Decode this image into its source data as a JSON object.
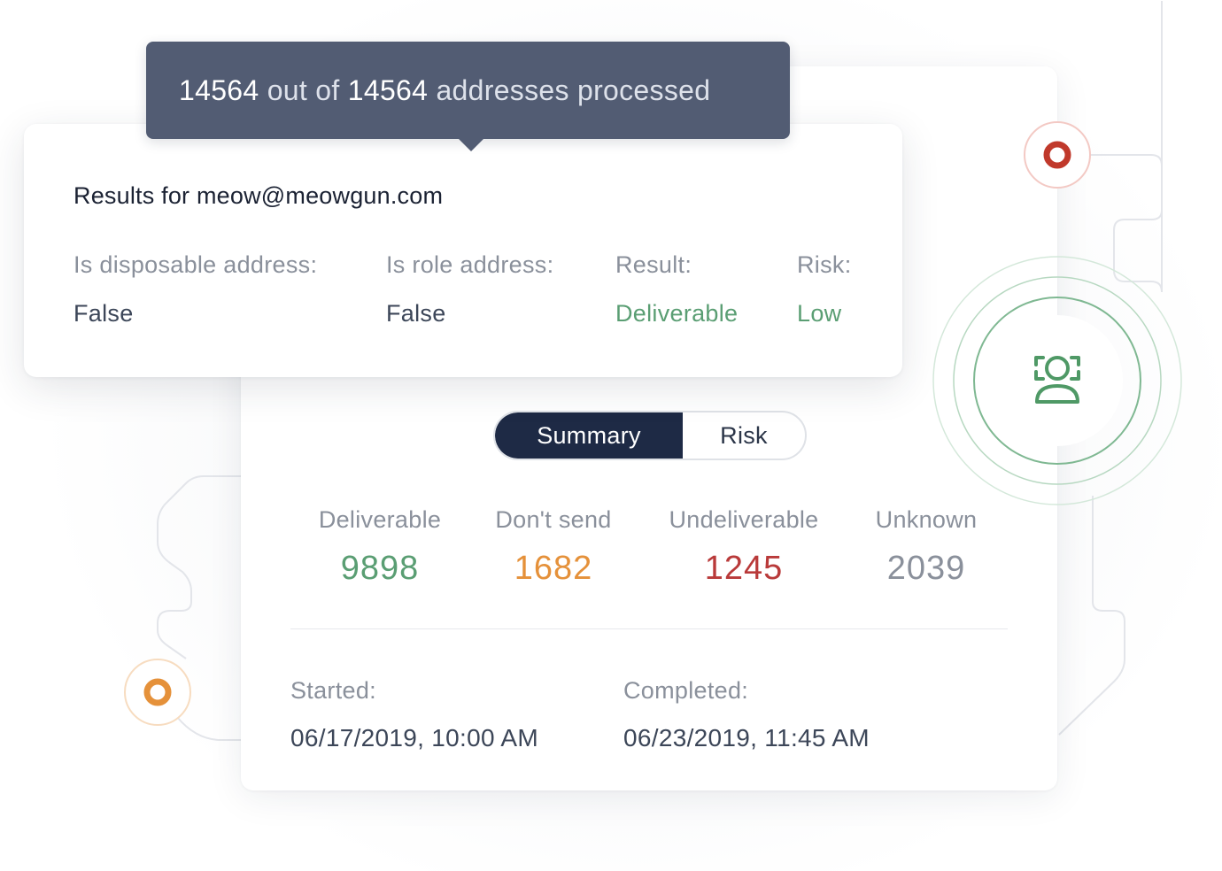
{
  "tooltip": {
    "processed_count": "14564",
    "connector_1": "out of",
    "total_count": "14564",
    "suffix": "addresses processed"
  },
  "results": {
    "title": "Results for meow@meowgun.com",
    "fields": [
      {
        "label": "Is disposable address:",
        "value": "False",
        "color": "#3c4658"
      },
      {
        "label": "Is role address:",
        "value": "False",
        "color": "#3c4658"
      },
      {
        "label": "Result:",
        "value": "Deliverable",
        "color": "#5a9e73"
      },
      {
        "label": "Risk:",
        "value": "Low",
        "color": "#5a9e73"
      }
    ]
  },
  "tabs": [
    {
      "label": "Summary",
      "active": true
    },
    {
      "label": "Risk",
      "active": false
    }
  ],
  "stats": [
    {
      "label": "Deliverable",
      "value": "9898",
      "color": "#5a9e73"
    },
    {
      "label": "Don't send",
      "value": "1682",
      "color": "#e5913a"
    },
    {
      "label": "Undeliverable",
      "value": "1245",
      "color": "#b93a3a"
    },
    {
      "label": "Unknown",
      "value": "2039",
      "color": "#8a909b"
    }
  ],
  "dates": {
    "started_label": "Started:",
    "started_value": "06/17/2019, 10:00 AM",
    "completed_label": "Completed:",
    "completed_value": "06/23/2019, 11:45 AM"
  },
  "colors": {
    "accent_dark": "#1e2a45",
    "tooltip_bg": "#525c73",
    "red_node": "#c0392b",
    "orange_node": "#e5913a",
    "green_ring": "#5a9e73"
  },
  "icons": {
    "center_badge": "person-scan-icon",
    "top_node": "red-dot-icon",
    "bottom_node": "orange-dot-icon"
  }
}
